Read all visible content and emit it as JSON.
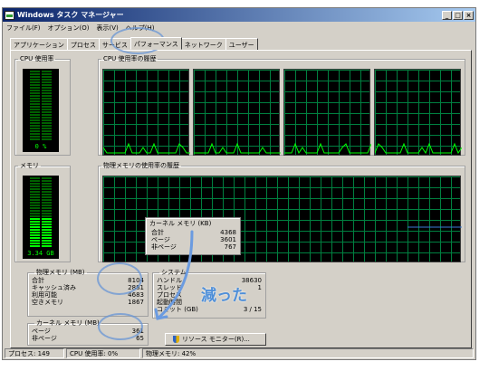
{
  "title": "Windows タスク マネージャー",
  "title_buttons": [
    "_",
    "□",
    "×"
  ],
  "menu": [
    "ファイル(F)",
    "オプション(O)",
    "表示(V)",
    "ヘルプ(H)"
  ],
  "tabs": [
    "アプリケーション",
    "プロセス",
    "サービス",
    "パフォーマンス",
    "ネットワーク",
    "ユーザー"
  ],
  "active_tab": "パフォーマンス",
  "groups": {
    "cpu_usage": "CPU 使用率",
    "cpu_history": "CPU 使用率の履歴",
    "memory": "メモリ",
    "memory_history": "物理メモリの使用率の履歴"
  },
  "cpu_meter_value": "0 %",
  "memory_meter_value": "3.34 GB",
  "cpu_meter_level": 0.0,
  "memory_meter_level": 0.41,
  "physical_memory": {
    "title": "物理メモリ (MB)",
    "rows": [
      {
        "label": "合計",
        "value": "8104"
      },
      {
        "label": "キャッシュ済み",
        "value": "2881"
      },
      {
        "label": "利用可能",
        "value": "4683"
      },
      {
        "label": "空きメモリ",
        "value": "1867"
      }
    ]
  },
  "kernel_memory": {
    "title": "カーネル メモリ (MB)",
    "rows": [
      {
        "label": "ページ",
        "value": "361"
      },
      {
        "label": "非ページ",
        "value": "65"
      }
    ]
  },
  "system": {
    "title": "システム",
    "rows": [
      {
        "label": "ハンドル",
        "value": "38630"
      },
      {
        "label": "スレッド",
        "value": "1"
      },
      {
        "label": "プロセス",
        "value": ""
      },
      {
        "label": "起動時間",
        "value": ""
      },
      {
        "label": "コミット (GB)",
        "value": "3 / 15"
      }
    ]
  },
  "resource_monitor_button": "リソース モニター(R)...",
  "popup": {
    "title": "カーネル メモリ (KB)",
    "rows": [
      {
        "label": "合計",
        "value": "4368"
      },
      {
        "label": "ページ",
        "value": "3601"
      },
      {
        "label": "非ページ",
        "value": "767"
      }
    ]
  },
  "annotation": "減った",
  "status": {
    "processes": "プロセス: 149",
    "cpu": "CPU 使用率: 0%",
    "memory": "物理メモリ: 42%"
  },
  "colors": {
    "graph_line": "#00ff00",
    "grid": "#008040",
    "memory_line": "#3a7ad6",
    "annotation": "#4f8fd8"
  }
}
